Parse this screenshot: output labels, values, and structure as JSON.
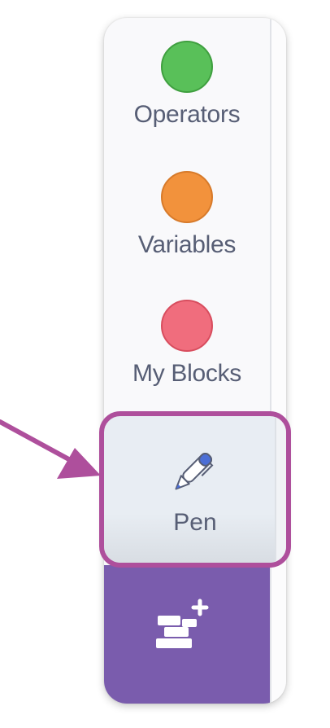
{
  "categories": [
    {
      "label": "Operators",
      "color": "#59c059",
      "border": "#3f9f3f"
    },
    {
      "label": "Variables",
      "color": "#f2923c",
      "border": "#d77a2a"
    },
    {
      "label": "My Blocks",
      "color": "#f06d7d",
      "border": "#d84d5e"
    }
  ],
  "pen": {
    "label": "Pen",
    "icon": "pen-icon"
  },
  "extension": {
    "icon": "add-extension-icon",
    "color": "#7a5cad"
  },
  "highlight_color": "#ae4f9c"
}
